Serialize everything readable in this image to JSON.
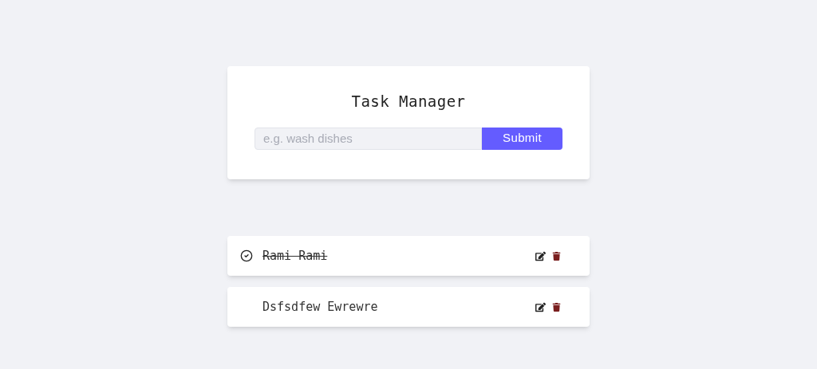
{
  "title": "Task Manager",
  "form": {
    "placeholder": "e.g. wash dishes",
    "submit": "Submit"
  },
  "tasks": [
    {
      "name": "Rami Rami",
      "completed": true
    },
    {
      "name": "Dsfsdfew Ewrewre",
      "completed": false
    }
  ]
}
